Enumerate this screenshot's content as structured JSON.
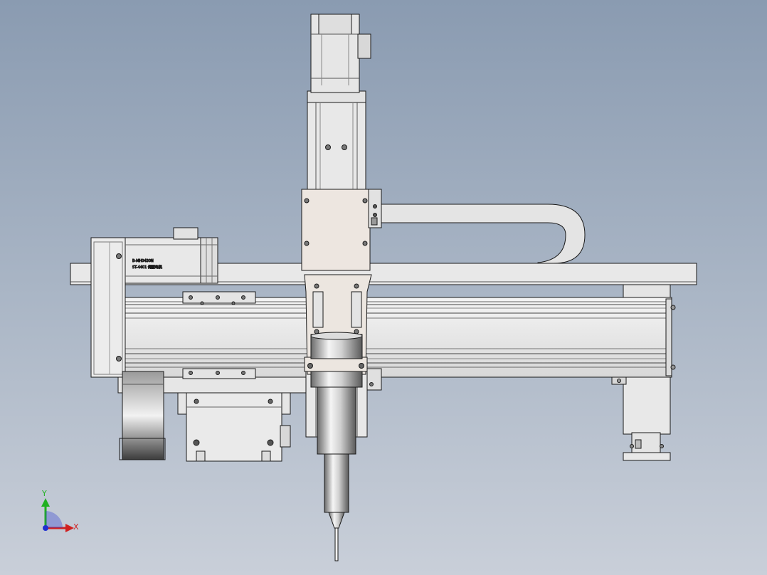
{
  "motor_label": {
    "line1": "B-MH0430N",
    "line2": "ST-4401 伺服电机"
  },
  "triad": {
    "y_label": "Y",
    "x_label": "X"
  },
  "colors": {
    "background_top": "#8a9bb1",
    "background_bottom": "#c9cfd9",
    "part_fill": "#e6e6e6",
    "plate_fill": "#ece6e0",
    "edge": "#1a1a1a",
    "axis_x": "#d02020",
    "axis_y": "#20b020",
    "axis_z": "#2030d0"
  }
}
